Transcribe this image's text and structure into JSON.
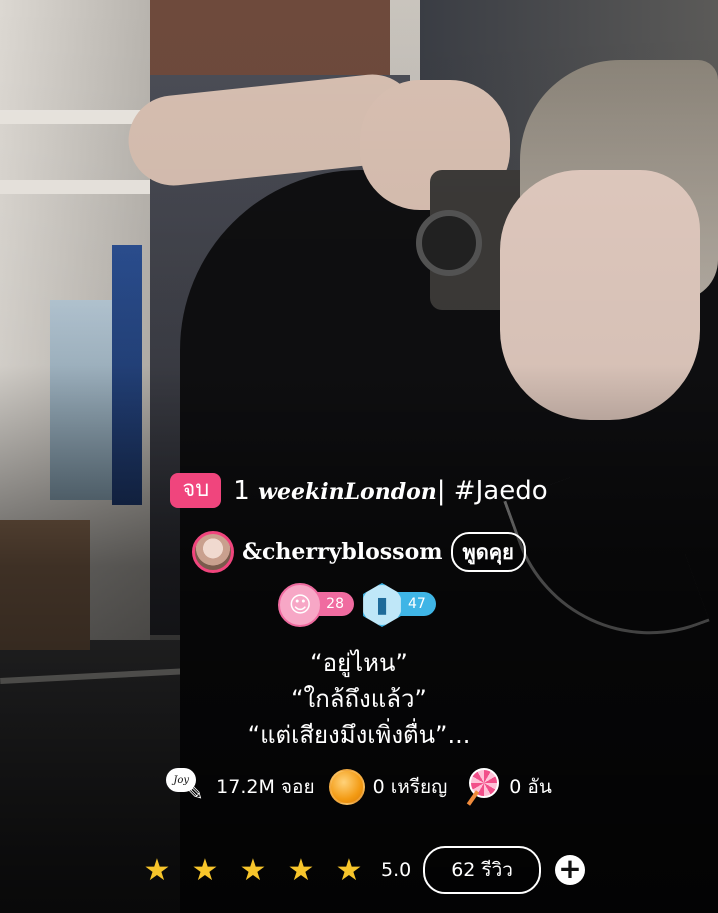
{
  "story": {
    "status_badge": "จบ",
    "title_prefix": "1",
    "title_stylized": "weekinLondon",
    "title_suffix": "| #Jaedo",
    "author": "&cherryblossom",
    "talk_button": "พูดคุย"
  },
  "stats": {
    "smile_count": "28",
    "bottle_count": "47"
  },
  "quotes": [
    "“อยู่ไหน”",
    "“ใกล้ถึงแล้ว”",
    "“แต่เสียงมึงเพิ่งตื่น”..."
  ],
  "meta": {
    "joy_icon_text": "Joy",
    "joy_count": "17.2M จอย",
    "coin_count": "0 เหรียญ",
    "candy_count": "0 อัน"
  },
  "rating": {
    "stars": 5,
    "value": "5.0",
    "reviews_button": "62 รีวิว",
    "add_button": "+"
  },
  "colors": {
    "accent_pink": "#f0457d",
    "stat_pink": "#f06ba0",
    "stat_blue": "#3fb5e6",
    "star": "#f7c52b"
  }
}
